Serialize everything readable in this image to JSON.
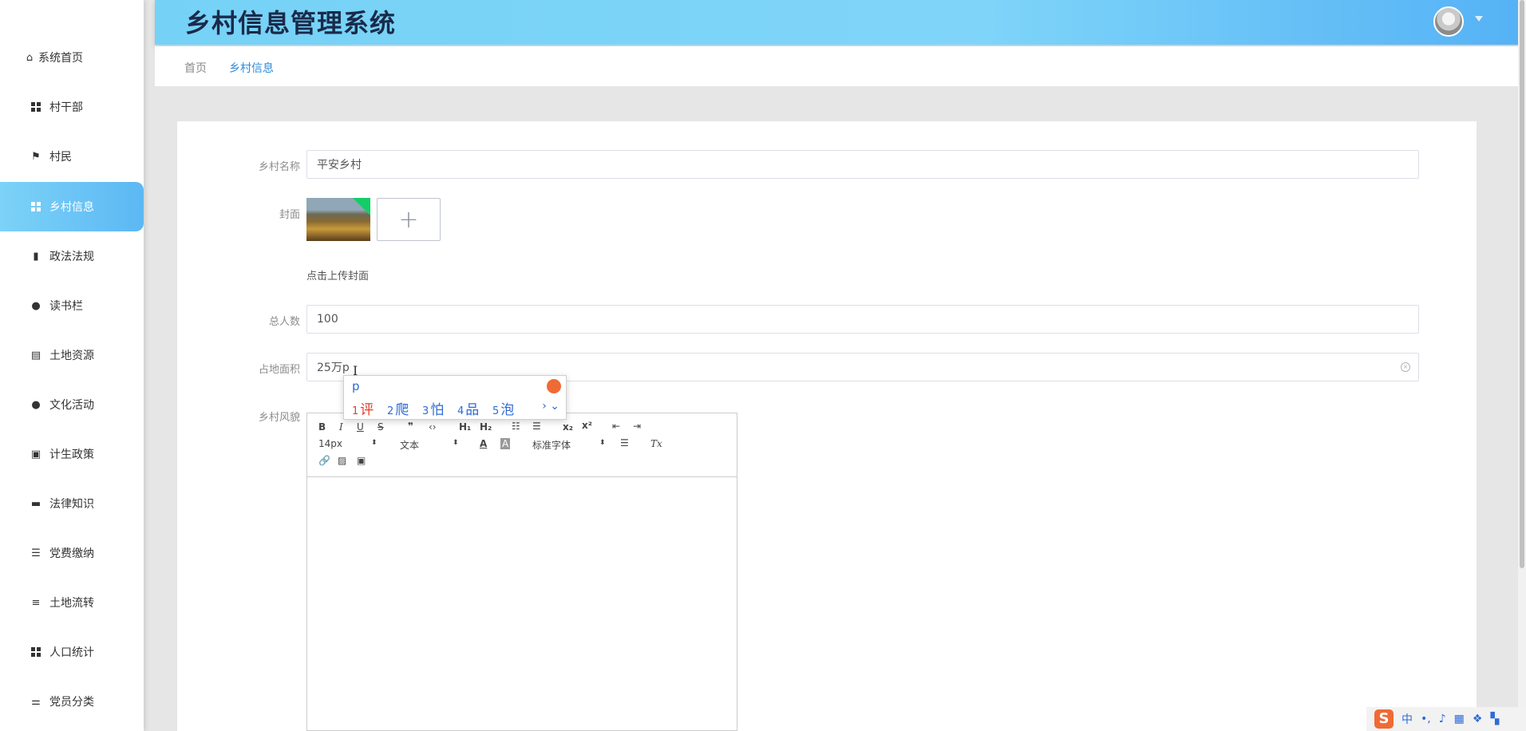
{
  "header": {
    "title": "乡村信息管理系统"
  },
  "sidebar": {
    "items": [
      {
        "label": "系统首页",
        "icon": "home-icon"
      },
      {
        "label": "村干部",
        "icon": "grid-icon"
      },
      {
        "label": "村民",
        "icon": "flag-icon"
      },
      {
        "label": "乡村信息",
        "icon": "grid-icon",
        "active": true
      },
      {
        "label": "政法法规",
        "icon": "bar-chart-icon"
      },
      {
        "label": "读书栏",
        "icon": "user-icon"
      },
      {
        "label": "土地资源",
        "icon": "clipboard-icon"
      },
      {
        "label": "文化活动",
        "icon": "location-pin-icon"
      },
      {
        "label": "计生政策",
        "icon": "line-chart-icon"
      },
      {
        "label": "法律知识",
        "icon": "briefcase-icon"
      },
      {
        "label": "党费缴纳",
        "icon": "list-icon"
      },
      {
        "label": "土地流转",
        "icon": "menu-icon"
      },
      {
        "label": "人口统计",
        "icon": "grid-icon"
      },
      {
        "label": "党员分类",
        "icon": "sliders-icon"
      }
    ]
  },
  "breadcrumb": {
    "home": "首页",
    "current": "乡村信息"
  },
  "form": {
    "name_label": "乡村名称",
    "name_value": "平安乡村",
    "cover_label": "封面",
    "cover_tip": "点击上传封面",
    "population_label": "总人数",
    "population_value": "100",
    "area_label": "占地面积",
    "area_value": "25万p",
    "scenery_label": "乡村风貌"
  },
  "editor": {
    "font_size": "14px",
    "paragraph": "文本",
    "font_family": "标准字体"
  },
  "ime": {
    "input": "p",
    "candidates": [
      {
        "num": "1",
        "text": "评"
      },
      {
        "num": "2",
        "text": "爬"
      },
      {
        "num": "3",
        "text": "怕"
      },
      {
        "num": "4",
        "text": "品"
      },
      {
        "num": "5",
        "text": "泡"
      }
    ]
  },
  "tray": {
    "lang": "中",
    "punct": "•,"
  },
  "colors": {
    "accent": "#5cb8f4",
    "header_start": "#75d2f6",
    "link": "#2d8cdb"
  }
}
